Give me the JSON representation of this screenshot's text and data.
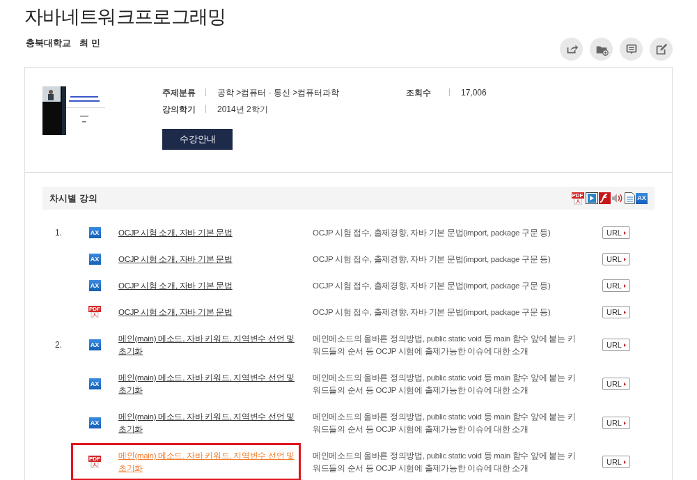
{
  "course": {
    "title": "자바네트워크프로그래밍",
    "school": "충북대학교",
    "instructor": "최 민"
  },
  "actions": [
    {
      "kind": "share"
    },
    {
      "kind": "folder"
    },
    {
      "kind": "comment"
    },
    {
      "kind": "edit"
    }
  ],
  "info": {
    "fields": [
      {
        "label": "주제분류",
        "value": "공학 >컴퓨터 · 통신 >컴퓨터과학"
      },
      {
        "label": "강의학기",
        "value": "2014년 2학기"
      }
    ],
    "views": {
      "label": "조회수",
      "value": "17,006"
    },
    "button": "수강안내"
  },
  "section": {
    "title": "차시별 강의",
    "legend": [
      {
        "kind": "pdf",
        "label": "PDF"
      },
      {
        "kind": "video"
      },
      {
        "kind": "flash"
      },
      {
        "kind": "audio"
      },
      {
        "kind": "doc"
      },
      {
        "kind": "ax",
        "label": "AX"
      }
    ]
  },
  "rows": [
    {
      "number": "1.",
      "kind": "ax",
      "icon_label": "AX",
      "title": "OCJP 시험 소개, 자바 기본 문법",
      "description": "OCJP 시험 접수, 출제경향, 자바 기본 문법(import, package 구문 등)",
      "url": "URL",
      "selected": false
    },
    {
      "kind": "ax",
      "icon_label": "AX",
      "title": "OCJP 시험 소개, 자바 기본 문법",
      "description": "OCJP 시험 접수, 출제경향, 자바 기본 문법(import, package 구문 등)",
      "url": "URL",
      "selected": false
    },
    {
      "kind": "ax",
      "icon_label": "AX",
      "title": "OCJP 시험 소개, 자바 기본 문법",
      "description": "OCJP 시험 접수, 출제경향, 자바 기본 문법(import, package 구문 등)",
      "url": "URL",
      "selected": false
    },
    {
      "kind": "pdf",
      "icon_label": "PDF",
      "title": "OCJP 시험 소개, 자바 기본 문법",
      "description": "OCJP 시험 접수, 출제경향, 자바 기본 문법(import, package 구문 등)",
      "url": "URL",
      "selected": false
    },
    {
      "number": "2.",
      "kind": "ax",
      "icon_label": "AX",
      "title": "메인(main) 메소드, 자바 키워드, 지역변수 선언 및 초기화",
      "description": "메인메소드의 올바른 정의방법, public static void 등 main 함수 앞에 붙는 키워드들의 순서 등 OCJP 시험에 출제가능한 이슈에 대한 소개",
      "url": "URL",
      "selected": false
    },
    {
      "kind": "ax",
      "icon_label": "AX",
      "title": "메인(main) 메소드, 자바 키워드, 지역변수 선언 및 초기화",
      "description": "메인메소드의 올바른 정의방법, public static void 등 main 함수 앞에 붙는 키워드들의 순서 등 OCJP 시험에 출제가능한 이슈에 대한 소개",
      "url": "URL",
      "selected": false
    },
    {
      "kind": "ax",
      "icon_label": "AX",
      "title": "메인(main) 메소드, 자바 키워드, 지역변수 선언 및 초기화",
      "description": "메인메소드의 올바른 정의방법, public static void 등 main 함수 앞에 붙는 키워드들의 순서 등 OCJP 시험에 출제가능한 이슈에 대한 소개",
      "url": "URL",
      "selected": false
    },
    {
      "kind": "pdf",
      "icon_label": "PDF",
      "title": "메인(main) 메소드, 자바 키워드, 지역변수 선언 및 초기화",
      "description": "메인메소드의 올바른 정의방법, public static void 등 main 함수 앞에 붙는 키워드들의 순서 등 OCJP 시험에 출제가능한 이슈에 대한 소개",
      "url": "URL",
      "selected": true
    }
  ]
}
